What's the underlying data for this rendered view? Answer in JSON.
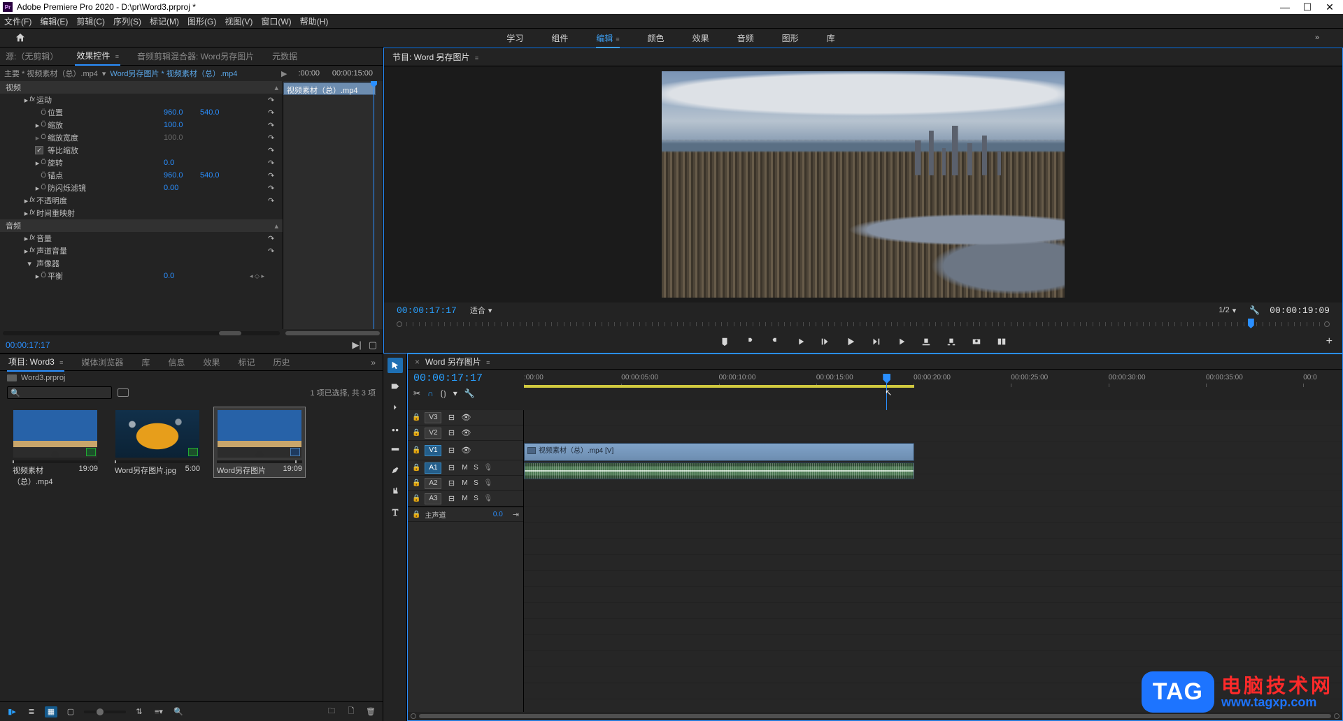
{
  "title_bar": {
    "app": "Adobe Premiere Pro 2020",
    "separator": " - ",
    "path": "D:\\pr\\Word3.prproj *"
  },
  "menu": {
    "file": "文件(F)",
    "edit": "编辑(E)",
    "clip": "剪辑(C)",
    "sequence": "序列(S)",
    "markers": "标记(M)",
    "graphics": "图形(G)",
    "view": "视图(V)",
    "window": "窗口(W)",
    "help": "帮助(H)"
  },
  "workspaces": {
    "learn": "学习",
    "assembly": "组件",
    "editing": "编辑",
    "color": "颜色",
    "effects": "效果",
    "audio": "音频",
    "captions": "图形",
    "libraries": "库"
  },
  "source_panel": {
    "tabs": {
      "source": "源:（无剪辑）",
      "effect_controls": "效果控件",
      "audio_mixer": "音频剪辑混合器: Word另存图片",
      "metadata": "元数据"
    },
    "master": "主要 * 视频素材（总）.mp4",
    "sub": "Word另存图片 * 视频素材（总）.mp4",
    "time_start": ":00:00",
    "time_end": "00:00:15:00",
    "clip_label": "视频素材（总）.mp4",
    "sections": {
      "video": "视频",
      "audio": "音频"
    },
    "rows": {
      "motion": "运动",
      "position": "位置",
      "position_x": "960.0",
      "position_y": "540.0",
      "scale": "缩放",
      "scale_v": "100.0",
      "scale_w": "缩放宽度",
      "scale_w_v": "100.0",
      "uniform": "等比缩放",
      "rotation": "旋转",
      "rotation_v": "0.0",
      "anchor": "锚点",
      "anchor_x": "960.0",
      "anchor_y": "540.0",
      "antiflicker": "防闪烁滤镜",
      "antiflicker_v": "0.00",
      "opacity": "不透明度",
      "timeremap": "时间重映射",
      "volume": "音量",
      "channel_volume": "声道音量",
      "panner": "声像器",
      "balance": "平衡",
      "balance_v": "0.0"
    },
    "current_time": "00:00:17:17"
  },
  "project_panel": {
    "tabs": {
      "project": "项目: Word3",
      "media_browser": "媒体浏览器",
      "libraries": "库",
      "info": "信息",
      "effects": "效果",
      "markers": "标记",
      "history": "历史"
    },
    "project_file": "Word3.prproj",
    "info_text": "1 项已选择, 共 3 项",
    "items": [
      {
        "name": "视频素材（总）.mp4",
        "dur": "19:09"
      },
      {
        "name": "Word另存图片.jpg",
        "dur": "5:00"
      },
      {
        "name": "Word另存图片",
        "dur": "19:09"
      }
    ]
  },
  "program_panel": {
    "tab": "节目: Word 另存图片",
    "time_left": "00:00:17:17",
    "fit": "适合",
    "zoom": "1/2",
    "time_right": "00:00:19:09"
  },
  "timeline": {
    "tab": "Word 另存图片",
    "time": "00:00:17:17",
    "ruler": [
      ":00:00",
      "00:00:05:00",
      "00:00:10:00",
      "00:00:15:00",
      "00:00:20:00",
      "00:00:25:00",
      "00:00:30:00",
      "00:00:35:00",
      "00:0"
    ],
    "tracks": {
      "v3": "V3",
      "v2": "V2",
      "v1": "V1",
      "a1": "A1",
      "a2": "A2",
      "a3": "A3",
      "master": "主声道",
      "master_val": "0.0"
    },
    "clip_v": "视频素材（总）.mp4 [V]"
  },
  "watermark": {
    "tag": "TAG",
    "cn": "电脑技术网",
    "url": "www.tagxp.com"
  }
}
